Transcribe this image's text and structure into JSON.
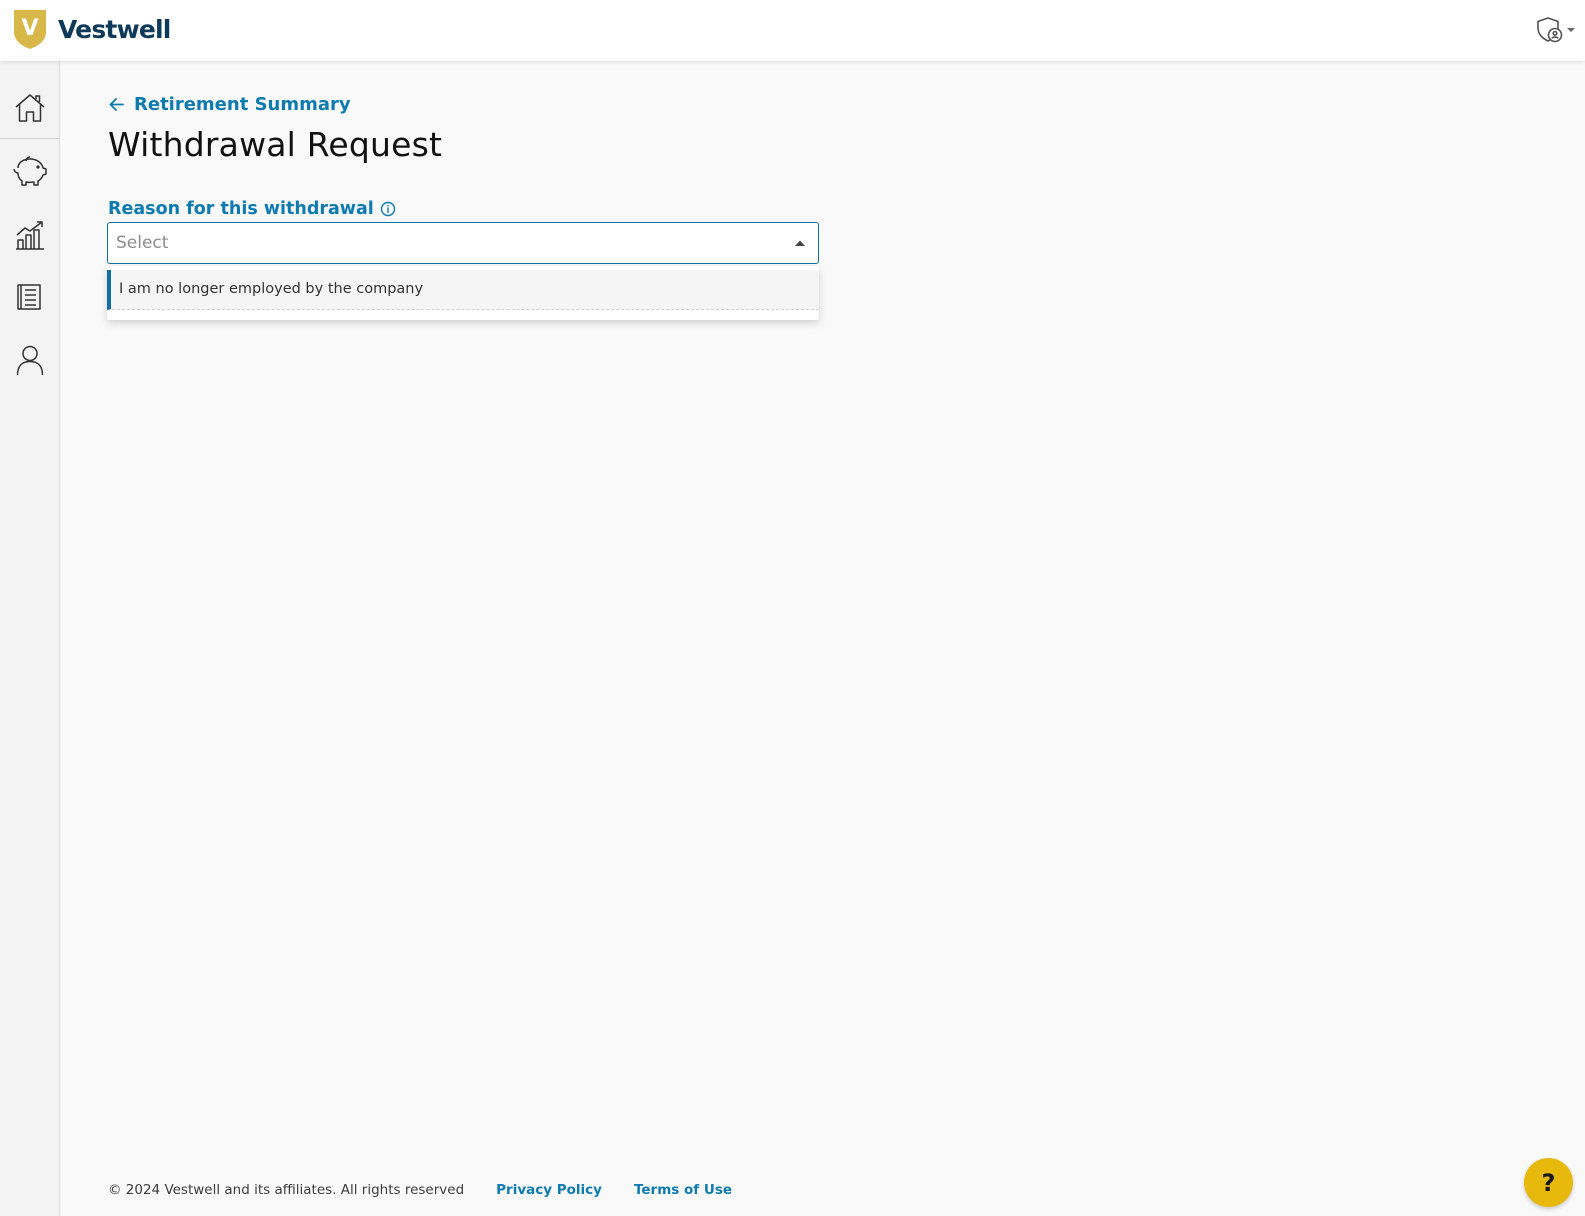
{
  "header": {
    "brand_name": "Vestwell",
    "brand_initial": "V",
    "logo_icon": "vestwell-shield-icon",
    "account_icon": "shield-user-icon",
    "brand_color": "#0e3a5a",
    "logo_color": "#d9b84a"
  },
  "sidebar": {
    "items": [
      {
        "icon": "home-icon",
        "label": "Home"
      },
      {
        "icon": "piggy-bank-icon",
        "label": "Savings"
      },
      {
        "icon": "chart-growth-icon",
        "label": "Investments"
      },
      {
        "icon": "document-list-icon",
        "label": "Documents"
      },
      {
        "icon": "user-icon",
        "label": "Profile"
      }
    ]
  },
  "main": {
    "back_link": "Retirement Summary",
    "title": "Withdrawal Request",
    "reason_field": {
      "label": "Reason for this withdrawal",
      "placeholder": "Select",
      "options": [
        "I am no longer employed by the company"
      ]
    }
  },
  "footer": {
    "copyright": "© 2024 Vestwell and its affiliates. All rights reserved",
    "privacy_link": "Privacy Policy",
    "terms_link": "Terms of Use"
  },
  "help": {
    "label": "?"
  },
  "colors": {
    "accent": "#0e7bb0",
    "help_button": "#e8b90d"
  }
}
